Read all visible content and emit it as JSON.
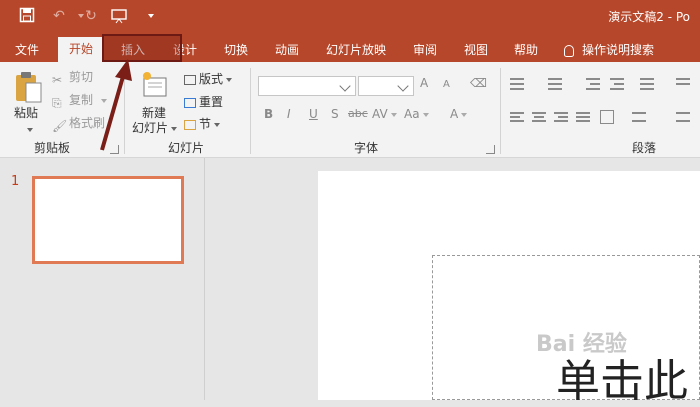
{
  "app": {
    "doc_title": "演示文稿2 - Po"
  },
  "quick_access": {
    "icons": [
      "save-icon",
      "undo-icon",
      "redo-icon",
      "present-from-start-icon",
      "customize-qat-icon"
    ]
  },
  "tabs": [
    "文件",
    "开始",
    "插入",
    "设计",
    "切换",
    "动画",
    "幻灯片放映",
    "审阅",
    "视图",
    "帮助"
  ],
  "active_tab": "开始",
  "highlighted_tab": "插入",
  "tell_me": "操作说明搜索",
  "ribbon": {
    "clipboard": {
      "label": "剪贴板",
      "paste": "粘贴",
      "cut": "剪切",
      "copy": "复制",
      "format_painter": "格式刷"
    },
    "slides": {
      "label": "幻灯片",
      "new_slide_line1": "新建",
      "new_slide_line2": "幻灯片",
      "layout": "版式",
      "reset": "重置",
      "section": "节"
    },
    "font": {
      "label": "字体",
      "font_name": "",
      "font_size": "",
      "bold": "B",
      "italic": "I",
      "underline": "U",
      "shadow": "S",
      "strike": "abc",
      "spacing": "AV",
      "case": "Aa",
      "color": "A",
      "grow": "A",
      "shrink": "A"
    },
    "paragraph": {
      "label": "段落"
    }
  },
  "thumbnails": [
    {
      "number": "1"
    }
  ],
  "slide": {
    "placeholder_text": "单击此"
  },
  "watermark": "Bai 经验",
  "colors": {
    "accent": "#b7472a",
    "highlight_border": "#6e1a14",
    "thumb_border": "#e07a55"
  }
}
